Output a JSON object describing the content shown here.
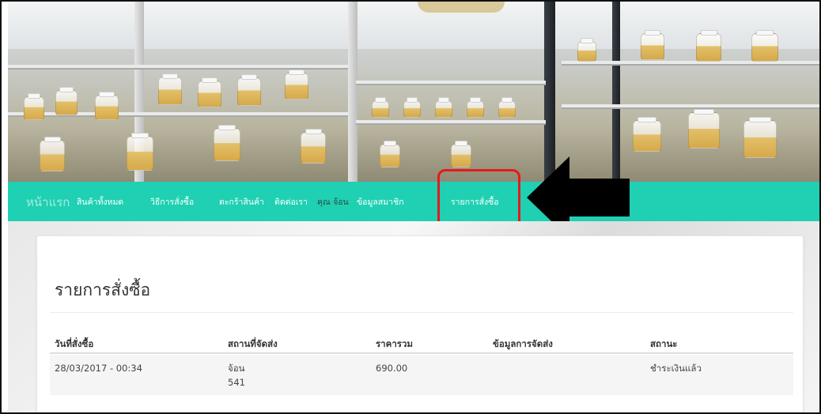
{
  "nav": {
    "items": [
      {
        "id": "home",
        "label": "หน้าแรก"
      },
      {
        "id": "all-products",
        "label": "สินค้าทั้งหมด"
      },
      {
        "id": "how-to-order",
        "label": "วิธีการสั่งซื้อ"
      },
      {
        "id": "cart",
        "label": "ตะกร้าสินค้า"
      },
      {
        "id": "contact",
        "label": "ติดต่อเรา"
      },
      {
        "id": "user",
        "label": "คุณ จ้อน"
      },
      {
        "id": "member-info",
        "label": "ข้อมูลสมาชิก"
      },
      {
        "id": "order-list",
        "label": "รายการสั่งซื้อ"
      }
    ]
  },
  "page": {
    "title": "รายการสั่งซื้อ"
  },
  "table": {
    "headers": [
      "วันที่สั่งซื้อ",
      "สถานที่จัดส่ง",
      "ราคารวม",
      "ข้อมูลการจัดส่ง",
      "สถานะ"
    ],
    "rows": [
      {
        "date": "28/03/2017 - 00:34",
        "recipient": "จ้อน",
        "address": "541",
        "total": "690.00",
        "shipping_info": "",
        "status": "ชำระเงินแล้ว"
      }
    ]
  },
  "colors": {
    "nav_bg": "#1fd0b3",
    "highlight": "#e21b1b",
    "arrow": "#000000"
  },
  "annotation": {
    "highlight_target": "nav.items.7",
    "arrow_icon": "arrow-left-icon"
  }
}
